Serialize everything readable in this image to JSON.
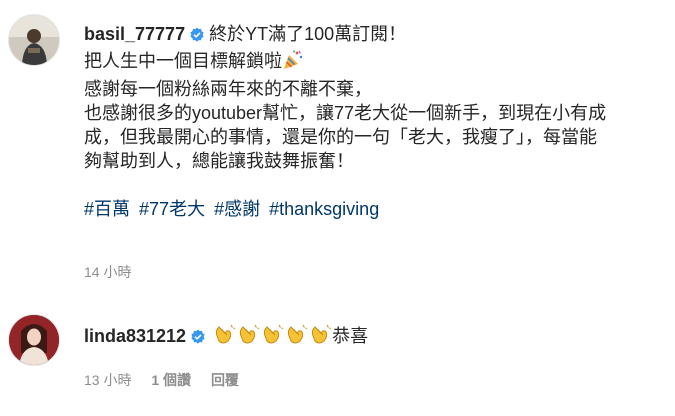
{
  "caption": {
    "username": "basil_77777",
    "lines": [
      "終於YT滿了100萬訂閱！",
      "把人生中一個目標解鎖啦",
      "感謝每一個粉絲兩年來的不離不棄，",
      "也感謝很多的youtuber幫忙，讓77老大從一個新手，到現在小有成",
      "成，但我最開心的事情，還是你的一句「老大，我瘦了」，每當能",
      "夠幫助到人，總能讓我鼓舞振奮！"
    ],
    "hashtags": [
      "#百萬",
      "#77老大",
      "#感謝",
      "#thanksgiving"
    ],
    "time": "14 小時"
  },
  "reply": {
    "username": "linda831212",
    "text": "恭喜",
    "time": "13 小時",
    "likes": "1 個讚",
    "reply_label": "回覆"
  },
  "icons": {
    "verified": "verified-badge-icon",
    "party": "party-popper-emoji",
    "clap": "clapping-hands-emoji"
  },
  "colors": {
    "verified": "#3897f0",
    "hashtag": "#00376b",
    "meta": "#8e8e8e"
  }
}
